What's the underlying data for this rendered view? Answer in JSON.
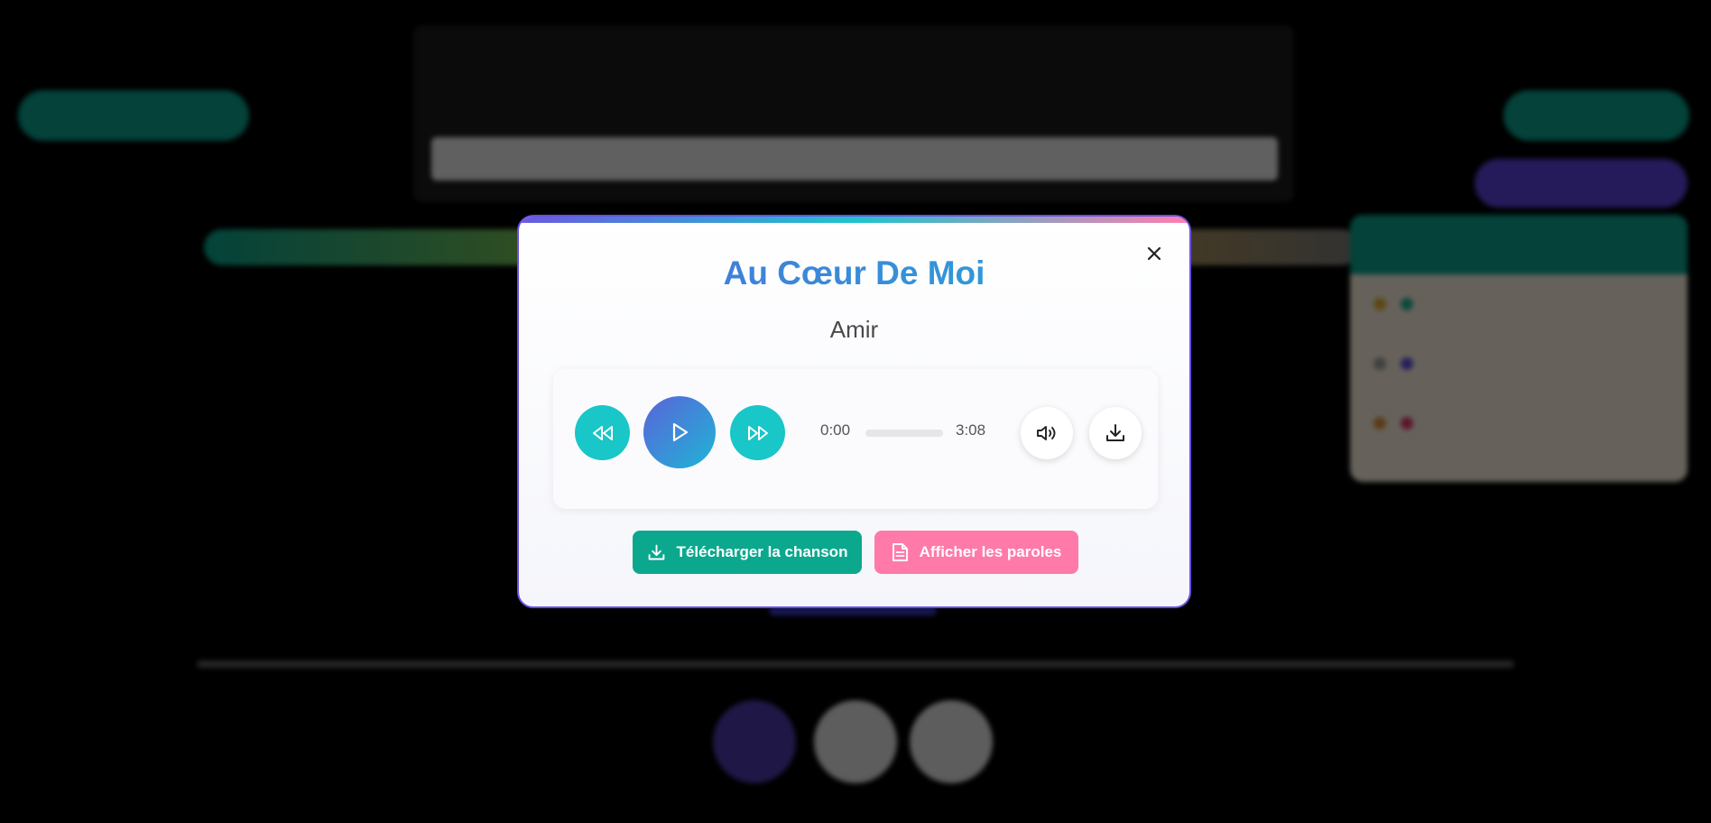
{
  "background": {
    "left_pill": "",
    "right_pill": "",
    "right_pill2": "",
    "card": {
      "title": "",
      "subtitle": "",
      "input_value": ""
    },
    "side_panel": {
      "title": "",
      "rows": [
        {
          "color": "#1fae8a"
        },
        {
          "color": "#5b4ad8"
        },
        {
          "color": "#e0306a"
        }
      ]
    }
  },
  "modal": {
    "title": "Au Cœur De Moi",
    "artist": "Amir",
    "player": {
      "current_time": "0:00",
      "total_time": "3:08",
      "progress": 0
    },
    "buttons": {
      "download": "Télécharger la chanson",
      "lyrics": "Afficher les paroles"
    }
  },
  "colors": {
    "accent_teal": "#19c6c8",
    "accent_green": "#0ba88e",
    "accent_pink": "#ff7aa8",
    "title_blue": "#3a8fd8",
    "modal_border": "#6a4fe0"
  },
  "icons": {
    "close": "close-icon",
    "rewind": "rewind-icon",
    "play": "play-icon",
    "forward": "fast-forward-icon",
    "volume": "volume-icon",
    "download": "download-icon",
    "document": "document-icon"
  }
}
